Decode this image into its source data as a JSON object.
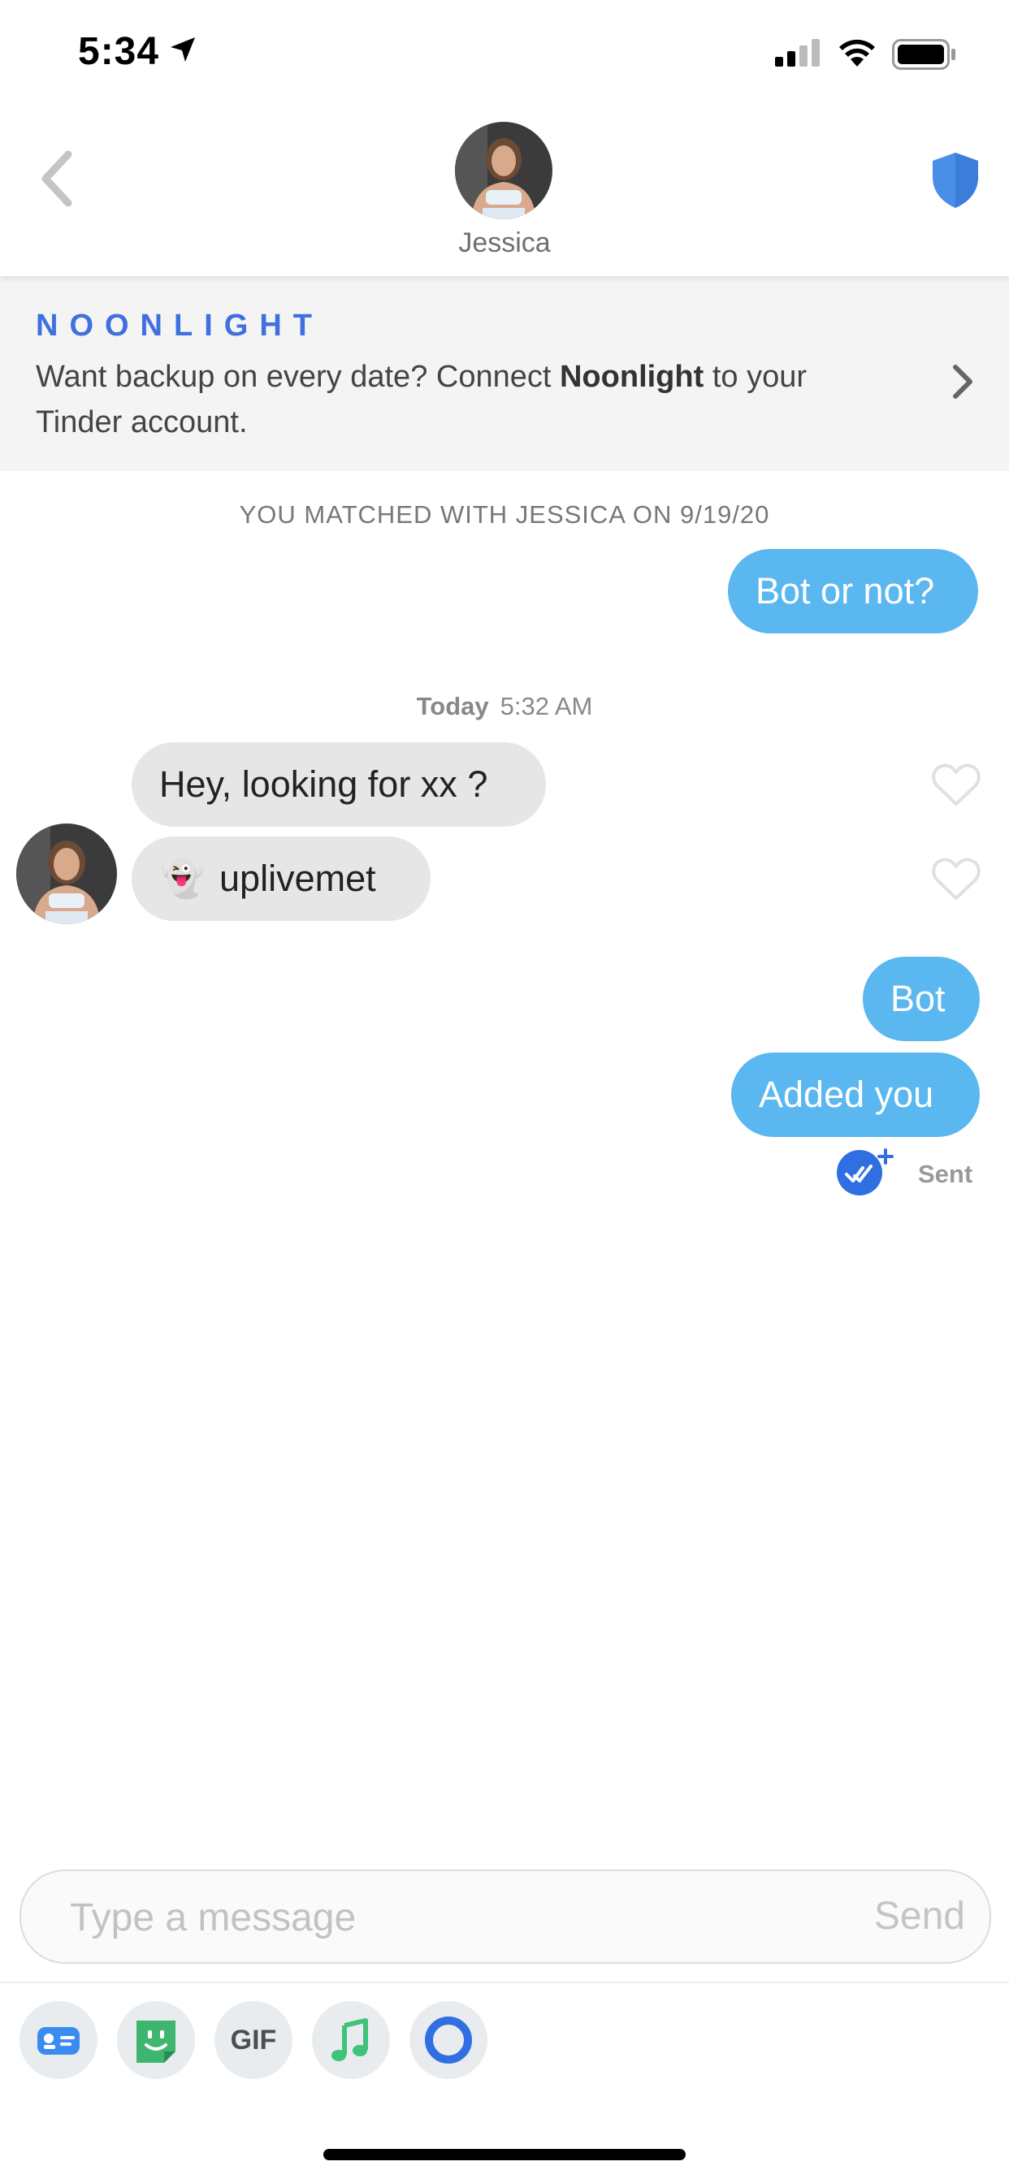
{
  "status_bar": {
    "time": "5:34"
  },
  "header": {
    "name": "Jessica",
    "back_icon": "chevron-left-icon",
    "safety_icon": "shield-icon"
  },
  "banner": {
    "logo": "NOONLIGHT",
    "text_before": "Want backup on every date? Connect ",
    "text_bold": "Noonlight",
    "text_after": " to your Tinder account."
  },
  "conversation": {
    "match_notice": "YOU MATCHED WITH JESSICA ON 9/19/20",
    "day": "Today",
    "time": "5:32 AM",
    "messages": [
      {
        "from": "me",
        "text": "Bot or not?"
      },
      {
        "from": "them",
        "text": "Hey, looking for xx ?"
      },
      {
        "from": "them",
        "emoji": "👻",
        "text": "uplivemet"
      },
      {
        "from": "me",
        "text": "Bot"
      },
      {
        "from": "me",
        "text": "Added you"
      }
    ],
    "sent_status": "Sent"
  },
  "composer": {
    "placeholder": "Type a message",
    "send_label": "Send"
  },
  "toolbar": {
    "gif_label": "GIF",
    "items": [
      "contact-card-icon",
      "sticker-icon",
      "gif-icon",
      "music-icon",
      "ring-icon"
    ]
  },
  "colors": {
    "my_bubble": "#5ab7ef",
    "their_bubble": "#e6e6e6",
    "accent_blue": "#3f6fe0"
  }
}
